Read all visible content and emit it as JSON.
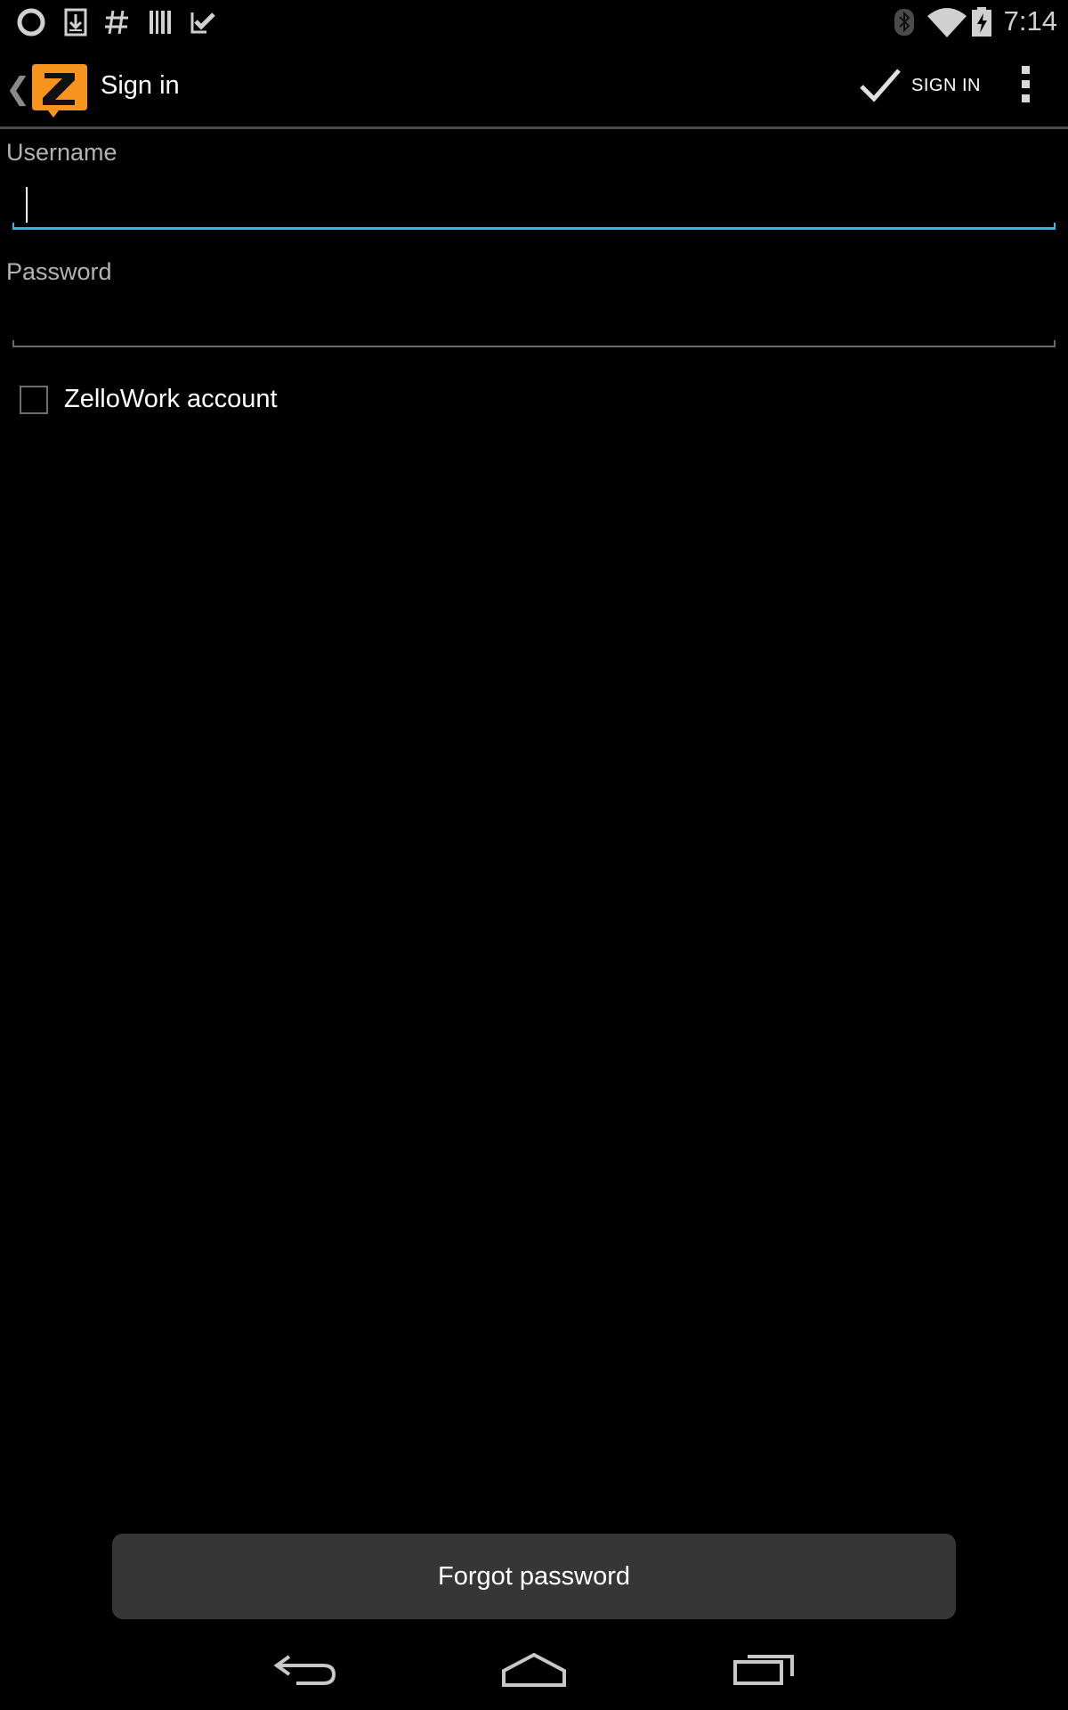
{
  "status_bar": {
    "time": "7:14",
    "left_icons": [
      "circle-icon",
      "download-icon",
      "hash-icon",
      "barcode-icon",
      "check-icon"
    ],
    "right_icons": [
      "bluetooth-icon",
      "wifi-icon",
      "battery-charging-icon"
    ]
  },
  "action_bar": {
    "title": "Sign in",
    "action_label": "SIGN IN",
    "logo_letter": "Z",
    "accent": "#f7941d"
  },
  "form": {
    "username_label": "Username",
    "username_value": "",
    "password_label": "Password",
    "password_value": "",
    "checkbox_label": "ZelloWork account",
    "checkbox_checked": false,
    "focus_color": "#33b5e5"
  },
  "forgot_label": "Forgot password",
  "nav_bar": {
    "buttons": [
      "back-icon",
      "home-icon",
      "recents-icon"
    ]
  }
}
